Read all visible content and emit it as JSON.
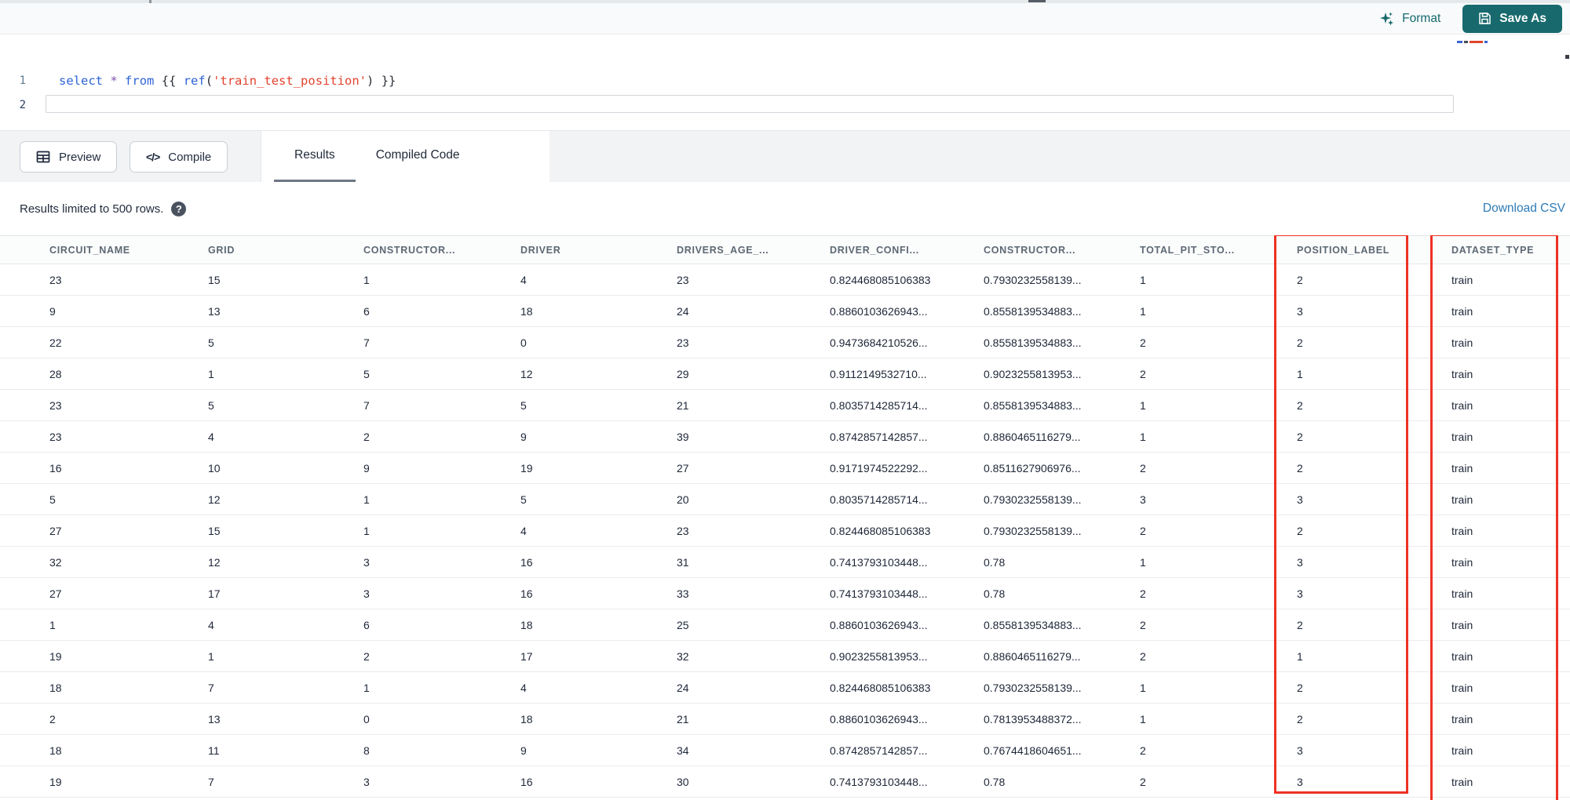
{
  "editor": {
    "line_numbers": [
      "1",
      "2"
    ],
    "code_line": "select * from {{ ref('train_test_position') }}",
    "tokens": [
      {
        "t": "select",
        "c": "kw"
      },
      {
        "t": " ",
        "c": "plain"
      },
      {
        "t": "*",
        "c": "star"
      },
      {
        "t": " ",
        "c": "plain"
      },
      {
        "t": "from",
        "c": "kw"
      },
      {
        "t": " ",
        "c": "plain"
      },
      {
        "t": "{{ ",
        "c": "brace"
      },
      {
        "t": "ref",
        "c": "fn"
      },
      {
        "t": "(",
        "c": "brace"
      },
      {
        "t": "'train_test_position'",
        "c": "str"
      },
      {
        "t": ")",
        "c": "brace"
      },
      {
        "t": " }}",
        "c": "brace"
      }
    ]
  },
  "top_bar": {
    "format_label": "Format",
    "save_as_label": "Save As"
  },
  "toolbar": {
    "preview_label": "Preview",
    "compile_label": "Compile",
    "compile_glyph": "</>"
  },
  "tabs": [
    {
      "label": "Results",
      "active": true
    },
    {
      "label": "Compiled Code",
      "active": false
    }
  ],
  "results": {
    "limit_text": "Results limited to 500 rows.",
    "help_glyph": "?",
    "download_label": "Download CSV"
  },
  "table": {
    "columns": [
      "CIRCUIT_NAME",
      "GRID",
      "CONSTRUCTOR...",
      "DRIVER",
      "DRIVERS_AGE_...",
      "DRIVER_CONFI...",
      "CONSTRUCTOR...",
      "TOTAL_PIT_STO...",
      "POSITION_LABEL",
      "DATASET_TYPE"
    ],
    "highlighted_columns": [
      "POSITION_LABEL",
      "DATASET_TYPE"
    ],
    "rows": [
      [
        "23",
        "15",
        "1",
        "4",
        "23",
        "0.824468085106383",
        "0.7930232558139...",
        "1",
        "2",
        "train"
      ],
      [
        "9",
        "13",
        "6",
        "18",
        "24",
        "0.8860103626943...",
        "0.8558139534883...",
        "1",
        "3",
        "train"
      ],
      [
        "22",
        "5",
        "7",
        "0",
        "23",
        "0.9473684210526...",
        "0.8558139534883...",
        "2",
        "2",
        "train"
      ],
      [
        "28",
        "1",
        "5",
        "12",
        "29",
        "0.9112149532710...",
        "0.9023255813953...",
        "2",
        "1",
        "train"
      ],
      [
        "23",
        "5",
        "7",
        "5",
        "21",
        "0.8035714285714...",
        "0.8558139534883...",
        "1",
        "2",
        "train"
      ],
      [
        "23",
        "4",
        "2",
        "9",
        "39",
        "0.8742857142857...",
        "0.8860465116279...",
        "1",
        "2",
        "train"
      ],
      [
        "16",
        "10",
        "9",
        "19",
        "27",
        "0.9171974522292...",
        "0.8511627906976...",
        "2",
        "2",
        "train"
      ],
      [
        "5",
        "12",
        "1",
        "5",
        "20",
        "0.8035714285714...",
        "0.7930232558139...",
        "3",
        "3",
        "train"
      ],
      [
        "27",
        "15",
        "1",
        "4",
        "23",
        "0.824468085106383",
        "0.7930232558139...",
        "2",
        "2",
        "train"
      ],
      [
        "32",
        "12",
        "3",
        "16",
        "31",
        "0.7413793103448...",
        "0.78",
        "1",
        "3",
        "train"
      ],
      [
        "27",
        "17",
        "3",
        "16",
        "33",
        "0.7413793103448...",
        "0.78",
        "2",
        "3",
        "train"
      ],
      [
        "1",
        "4",
        "6",
        "18",
        "25",
        "0.8860103626943...",
        "0.8558139534883...",
        "2",
        "2",
        "train"
      ],
      [
        "19",
        "1",
        "2",
        "17",
        "32",
        "0.9023255813953...",
        "0.8860465116279...",
        "2",
        "1",
        "train"
      ],
      [
        "18",
        "7",
        "1",
        "4",
        "24",
        "0.824468085106383",
        "0.7930232558139...",
        "1",
        "2",
        "train"
      ],
      [
        "2",
        "13",
        "0",
        "18",
        "21",
        "0.8860103626943...",
        "0.7813953488372...",
        "1",
        "2",
        "train"
      ],
      [
        "18",
        "11",
        "8",
        "9",
        "34",
        "0.8742857142857...",
        "0.7674418604651...",
        "2",
        "3",
        "train"
      ],
      [
        "19",
        "7",
        "3",
        "16",
        "30",
        "0.7413793103448...",
        "0.78",
        "2",
        "3",
        "train"
      ]
    ]
  },
  "colors": {
    "accent_teal": "#17696d",
    "link_blue": "#2e7cb8",
    "highlight_red": "#ee3223"
  }
}
